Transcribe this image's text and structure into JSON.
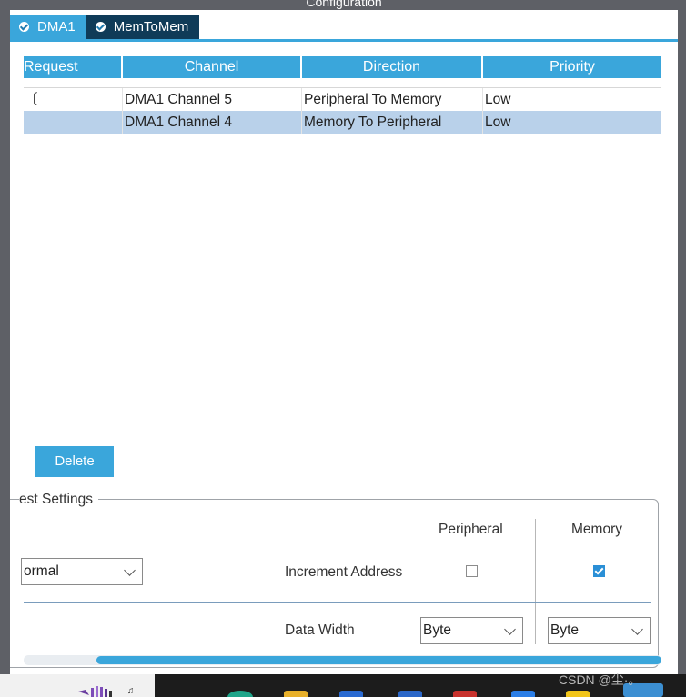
{
  "window": {
    "title": "Configuration"
  },
  "tabs": [
    {
      "label": "DMA1",
      "state": "active"
    },
    {
      "label": "MemToMem",
      "state": "inactive"
    }
  ],
  "table": {
    "columns": [
      "Request",
      "Channel",
      "Direction",
      "Priority"
    ],
    "rows": [
      {
        "request": "〔",
        "channel": "DMA1 Channel 5",
        "direction": "Peripheral To Memory",
        "priority": "Low",
        "selected": false
      },
      {
        "request": "",
        "channel": "DMA1 Channel 4",
        "direction": "Memory To Peripheral",
        "priority": "Low",
        "selected": true
      }
    ]
  },
  "buttons": {
    "delete": "Delete"
  },
  "settings": {
    "legend": "est Settings",
    "columns": {
      "peripheral": "Peripheral",
      "memory": "Memory"
    },
    "mode_select": {
      "value": "ormal"
    },
    "increment_address": {
      "label": "Increment Address",
      "peripheral_checked": false,
      "memory_checked": true
    },
    "data_width": {
      "label": "Data Width",
      "peripheral_value": "Byte",
      "memory_value": "Byte"
    }
  },
  "watermark": "CSDN @尘·。",
  "colors": {
    "accent": "#3aa6db",
    "tab_inactive": "#0f3b58",
    "selected_row": "#b9d1ea",
    "chrome": "#5e6066"
  }
}
